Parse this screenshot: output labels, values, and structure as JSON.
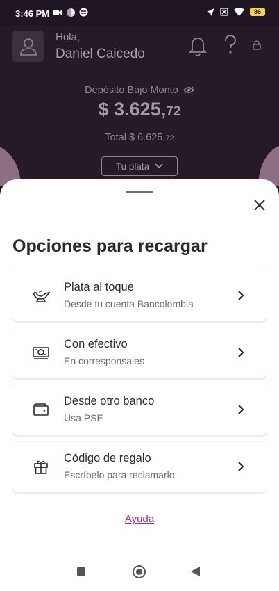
{
  "status_bar": {
    "time": "3:46 PM",
    "battery": "86"
  },
  "header": {
    "greeting": "Hola,",
    "user_name": "Daniel Caicedo",
    "deposit_label": "Depósito Bajo Monto",
    "balance_main": "$ 3.625,",
    "balance_cents": "72",
    "total_main": "Total $ 6.625,",
    "total_cents": "72",
    "plata_button": "Tu plata"
  },
  "sheet": {
    "title": "Opciones para recargar",
    "options": [
      {
        "title": "Plata al toque",
        "subtitle": "Desde tu cuenta Bancolombia",
        "icon": "genie-lamp-icon"
      },
      {
        "title": "Con efectivo",
        "subtitle": "En corresponsales",
        "icon": "cash-icon"
      },
      {
        "title": "Desde otro banco",
        "subtitle": "Usa PSE",
        "icon": "wallet-icon"
      },
      {
        "title": "Código de regalo",
        "subtitle": "Escríbelo para reclamarlo",
        "icon": "gift-icon"
      }
    ],
    "help_link": "Ayuda"
  },
  "colors": {
    "accent": "#d3206e",
    "header_bg": "#251a26",
    "text_dark": "#2c2a29"
  }
}
